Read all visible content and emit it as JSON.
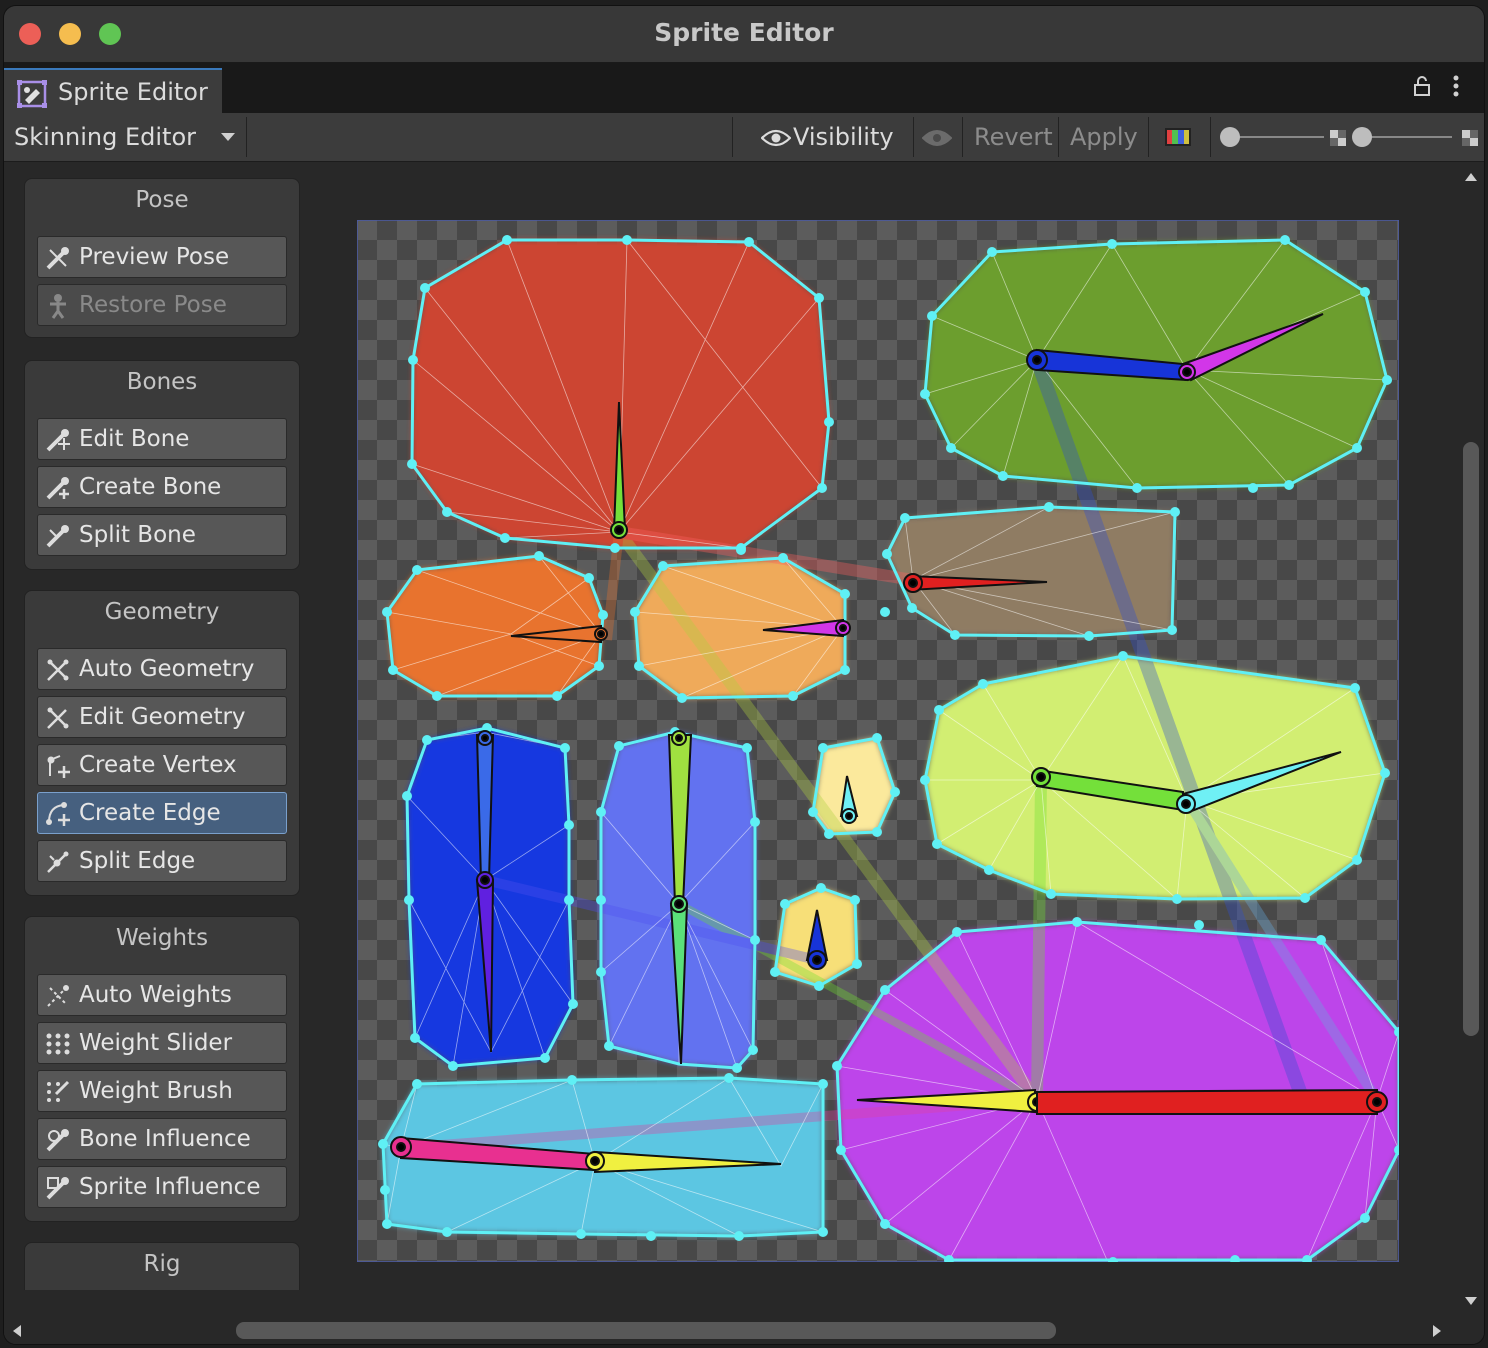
{
  "window": {
    "title": "Sprite Editor"
  },
  "tab": {
    "label": "Sprite Editor",
    "lock_icon": "lock-icon",
    "menu_icon": "kebab-menu-icon"
  },
  "toolbar": {
    "mode": "Skinning Editor",
    "visibility": "Visibility",
    "revert": "Revert",
    "apply": "Apply"
  },
  "panels": {
    "pose": {
      "title": "Pose",
      "preview_pose": "Preview Pose",
      "restore_pose": "Restore Pose"
    },
    "bones": {
      "title": "Bones",
      "edit_bone": "Edit Bone",
      "create_bone": "Create Bone",
      "split_bone": "Split Bone"
    },
    "geometry": {
      "title": "Geometry",
      "auto_geometry": "Auto Geometry",
      "edit_geometry": "Edit Geometry",
      "create_vertex": "Create Vertex",
      "create_edge": "Create Edge",
      "split_edge": "Split Edge"
    },
    "weights": {
      "title": "Weights",
      "auto_weights": "Auto Weights",
      "weight_slider": "Weight Slider",
      "weight_brush": "Weight Brush",
      "bone_influence": "Bone Influence",
      "sprite_influence": "Sprite Influence"
    },
    "rig": {
      "title": "Rig"
    }
  },
  "colors": {
    "accent": "#3a79bb",
    "outline": "#5ff0f5",
    "sprites": [
      "#cc4433",
      "#6c9e2e",
      "#8f7c63",
      "#e8732f",
      "#efaa5a",
      "#d2ee72",
      "#1939e0",
      "#6272f0",
      "#fbe99c",
      "#f7df78",
      "#bd45ea",
      "#5cc6e2"
    ]
  }
}
